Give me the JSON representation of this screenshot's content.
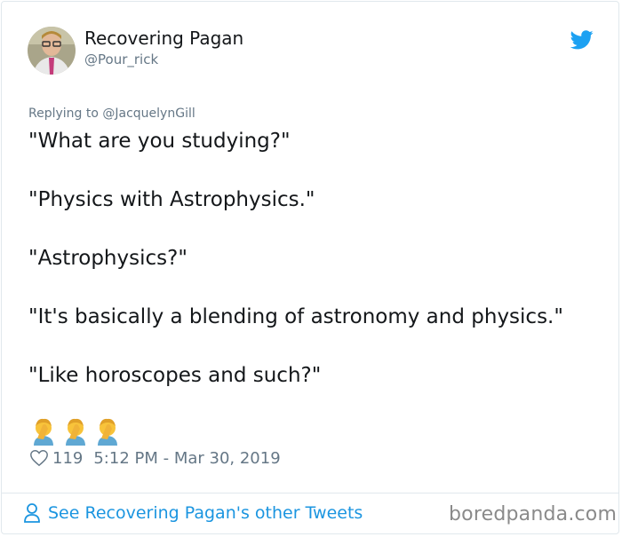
{
  "author": {
    "name": "Recovering Pagan",
    "handle": "@Pour_rick",
    "avatar_icon": "avatar-photo",
    "brand_icon": "twitter-bird-icon",
    "brand_color": "#1da1f2"
  },
  "reply_context": {
    "prefix": "Replying to ",
    "mention": "@JacquelynGill"
  },
  "tweet": {
    "lines": [
      "\"What are you studying?\"",
      "\"Physics with Astrophysics.\"",
      "\"Astrophysics?\"",
      "\"It's basically a blending of astronomy and physics.\"",
      "\"Like horoscopes and such?\""
    ],
    "emojis": [
      "facepalm-emoji",
      "facepalm-emoji",
      "facepalm-emoji"
    ]
  },
  "meta": {
    "likes": "119",
    "timestamp": "5:12 PM - Mar 30, 2019"
  },
  "footer": {
    "see_more_label": "See Recovering Pagan's other Tweets",
    "link_color": "#1b95e0",
    "watermark": "boredpanda.com"
  }
}
